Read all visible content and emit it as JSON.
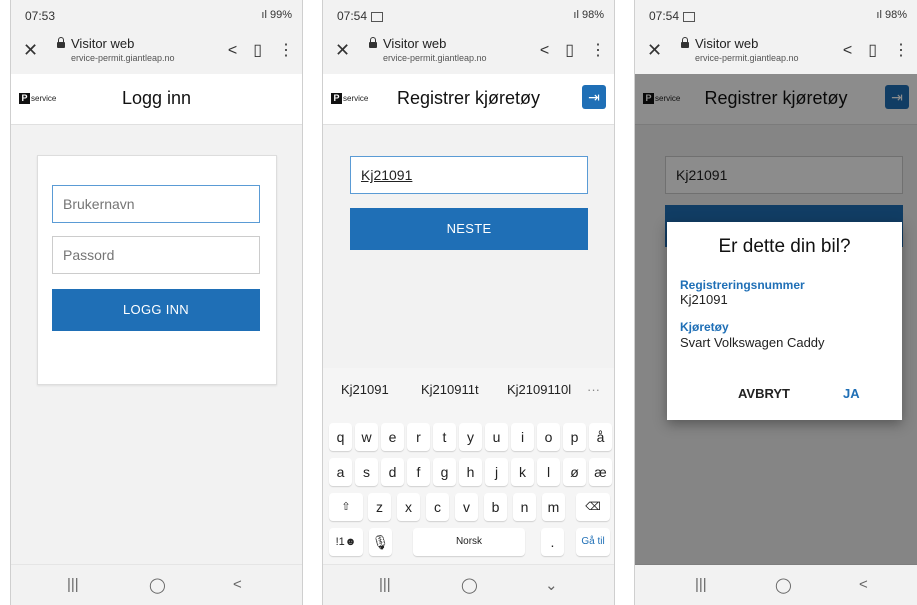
{
  "phone1": {
    "status": {
      "time": "07:53",
      "right": "99%"
    },
    "browser": {
      "title": "Visitor web",
      "url": "ervice-permit.giantleap.no"
    },
    "logo": {
      "mark": "P",
      "text": "service"
    },
    "heading": "Logg inn",
    "username_placeholder": "Brukernavn",
    "password_placeholder": "Passord",
    "login_button": "LOGG INN"
  },
  "phone2": {
    "status": {
      "time": "07:54",
      "right": "98%"
    },
    "browser": {
      "title": "Visitor web",
      "url": "ervice-permit.giantleap.no"
    },
    "logo": {
      "mark": "P",
      "text": "service"
    },
    "heading": "Registrer kjøretøy",
    "reg_value": "Kj21091",
    "next_button": "NESTE",
    "keyboard": {
      "suggestions": [
        "Kj21091",
        "Kj210911t",
        "Kj2109110l",
        "···"
      ],
      "row1": [
        "q",
        "w",
        "e",
        "r",
        "t",
        "y",
        "u",
        "i",
        "o",
        "p",
        "å"
      ],
      "row2": [
        "a",
        "s",
        "d",
        "f",
        "g",
        "h",
        "j",
        "k",
        "l",
        "ø",
        "æ"
      ],
      "row3": [
        "z",
        "x",
        "c",
        "v",
        "b",
        "n",
        "m"
      ],
      "sym_key": "!1☻",
      "space_label": "Norsk",
      "period_key": ".",
      "go_key": "Gå til"
    }
  },
  "phone3": {
    "status": {
      "time": "07:54",
      "right": "98%"
    },
    "browser": {
      "title": "Visitor web",
      "url": "ervice-permit.giantleap.no"
    },
    "logo": {
      "mark": "P",
      "text": "service"
    },
    "heading": "Registrer kjøretøy",
    "reg_value": "Kj21091",
    "dialog": {
      "title": "Er dette din bil?",
      "reg_label": "Registreringsnummer",
      "reg_value": "Kj21091",
      "vehicle_label": "Kjøretøy",
      "vehicle_value": "Svart Volkswagen Caddy",
      "cancel": "AVBRYT",
      "ok": "JA"
    }
  },
  "colors": {
    "primary": "#1f6fb6",
    "background": "#f2f2f2"
  }
}
